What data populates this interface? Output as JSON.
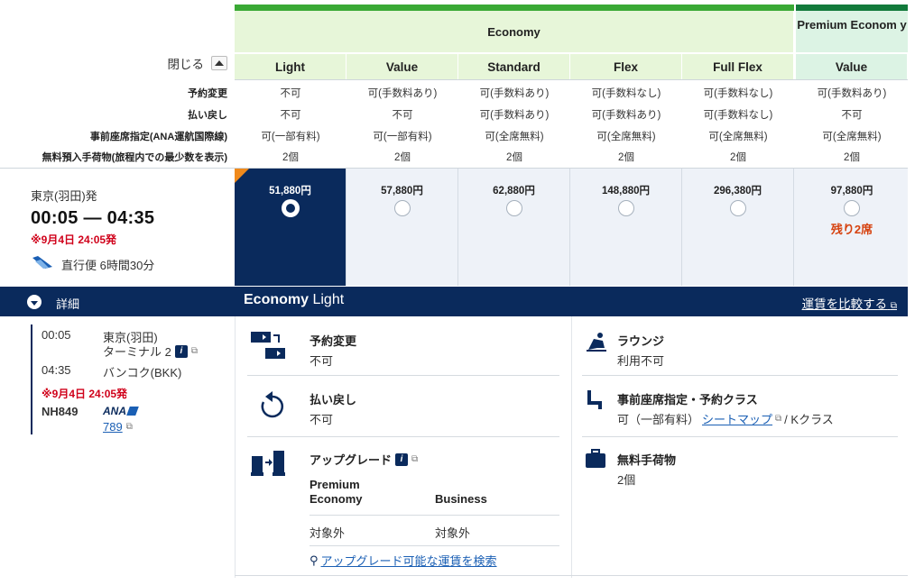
{
  "header": {
    "economy_label": "Economy",
    "premium_label": "Premium Econom y",
    "close_label": "閉じる"
  },
  "fare_columns": [
    {
      "name": "Light",
      "change": "不可",
      "refund": "不可",
      "seat": "可(一部有料)",
      "baggage": "2個",
      "price": "51,880円",
      "selected": true,
      "remaining": ""
    },
    {
      "name": "Value",
      "change": "可(手数料あり)",
      "refund": "不可",
      "seat": "可(一部有料)",
      "baggage": "2個",
      "price": "57,880円",
      "selected": false,
      "remaining": ""
    },
    {
      "name": "Standard",
      "change": "可(手数料あり)",
      "refund": "可(手数料あり)",
      "seat": "可(全席無料)",
      "baggage": "2個",
      "price": "62,880円",
      "selected": false,
      "remaining": ""
    },
    {
      "name": "Flex",
      "change": "可(手数料なし)",
      "refund": "可(手数料あり)",
      "seat": "可(全席無料)",
      "baggage": "2個",
      "price": "148,880円",
      "selected": false,
      "remaining": ""
    },
    {
      "name": "Full Flex",
      "change": "可(手数料なし)",
      "refund": "可(手数料なし)",
      "seat": "可(全席無料)",
      "baggage": "2個",
      "price": "296,380円",
      "selected": false,
      "remaining": ""
    },
    {
      "name": "Value",
      "change": "可(手数料あり)",
      "refund": "不可",
      "seat": "可(全席無料)",
      "baggage": "2個",
      "price": "97,880円",
      "selected": false,
      "remaining": "残り2席"
    }
  ],
  "conditions": {
    "change_label": "予約変更",
    "refund_label": "払い戻し",
    "seat_label": "事前座席指定(ANA運航国際線)",
    "baggage_label": "無料預入手荷物(旅程内での最少数を表示)"
  },
  "flight": {
    "departure": "東京(羽田)発",
    "times": "00:05 — 04:35",
    "date_note": "※9月4日 24:05発",
    "direct": "直行便 6時間30分"
  },
  "detail": {
    "toggle_label": "詳細",
    "title_bold": "Economy",
    "title_rest": " Light",
    "compare_label": "運賃を比較する"
  },
  "itinerary": {
    "dep_time": "00:05",
    "dep_airport": "東京(羽田)",
    "dep_terminal": "ターミナル 2",
    "arr_time": "04:35",
    "arr_airport": "バンコク(BKK)",
    "date_note": "※9月4日 24:05発",
    "flight_no": "NH849",
    "airline": "ANA",
    "aircraft": "789"
  },
  "fare_details": {
    "change_title": "予約変更",
    "change_value": "不可",
    "refund_title": "払い戻し",
    "refund_value": "不可",
    "upgrade_title": "アップグレード",
    "upgrade_col1": "Premium Economy",
    "upgrade_col2": "Business",
    "upgrade_val1": "対象外",
    "upgrade_val2": "対象外",
    "upgrade_search": "アップグレード可能な運賃を検索",
    "lounge_title": "ラウンジ",
    "lounge_value": "利用不可",
    "seat_title": "事前座席指定・予約クラス",
    "seat_value_pre": "可（一部有料）",
    "seat_map_link": "シートマップ",
    "seat_class": " / Kクラス",
    "baggage_title": "無料手荷物",
    "baggage_value": "2個"
  },
  "colors": {
    "navy": "#0a2a5c",
    "economy_green": "#3aa935",
    "premium_green": "#127a3b",
    "warning_red": "#d0021b",
    "remaining_orange": "#d6420f"
  }
}
